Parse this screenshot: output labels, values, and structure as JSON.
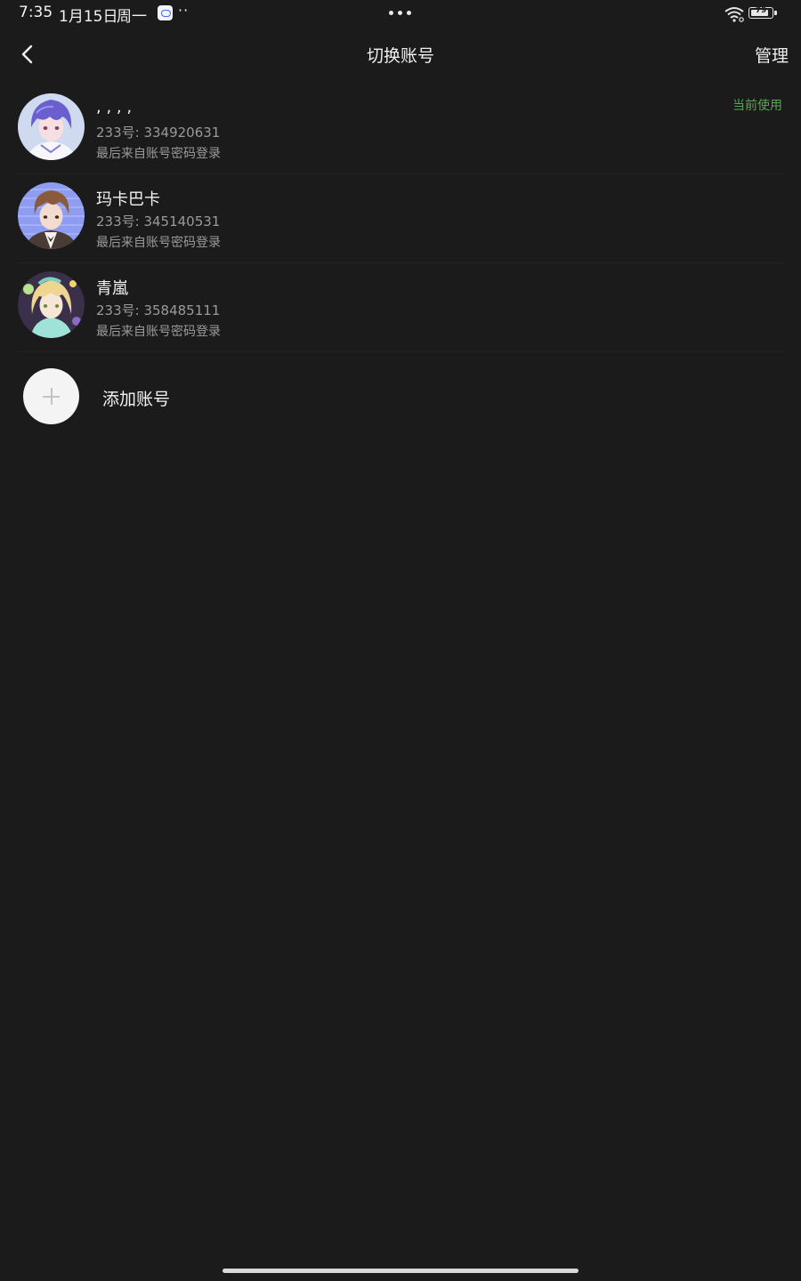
{
  "status_bar": {
    "time": "7:35",
    "date": "1月15日",
    "weekday": "周一",
    "more": "··",
    "battery": "79"
  },
  "header": {
    "title": "切换账号",
    "manage_label": "管理"
  },
  "accounts": [
    {
      "name": ", , , ,",
      "id": "233号: 334920631",
      "login_method": "最后来自账号密码登录",
      "badge": "当前使用"
    },
    {
      "name": "玛卡巴卡",
      "id": "233号: 345140531",
      "login_method": "最后来自账号密码登录"
    },
    {
      "name": "青嵐",
      "id": "233号: 358485111",
      "login_method": "最后来自账号密码登录"
    }
  ],
  "add_account_label": "添加账号",
  "colors": {
    "background": "#1b1b1b",
    "current_badge": "#5aa454",
    "secondary_text": "#9a9a9a"
  }
}
